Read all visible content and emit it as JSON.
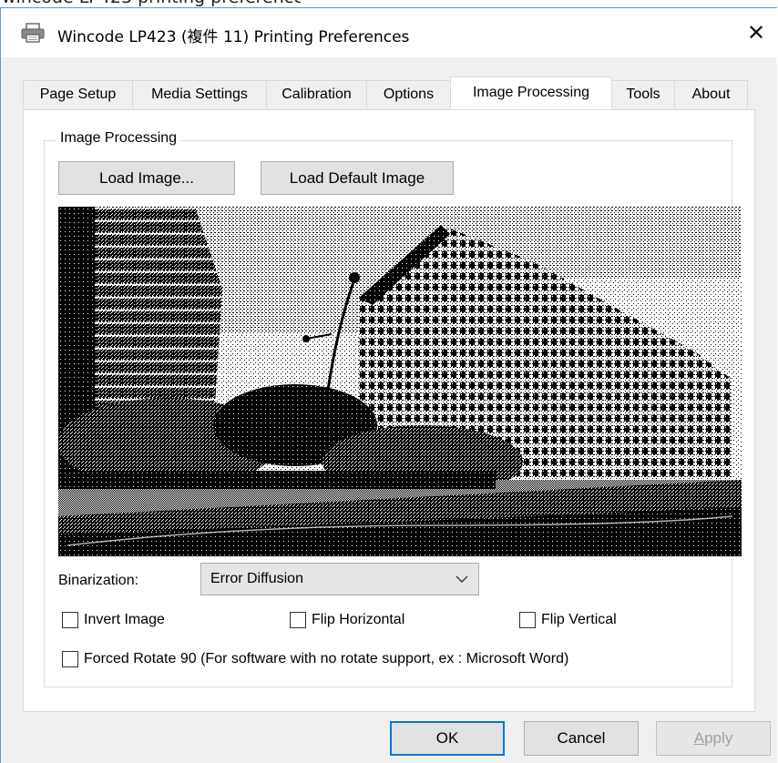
{
  "window": {
    "title": "Wincode LP423 (複件 11) Printing Preferences",
    "close_glyph": "✕",
    "printer_icon": "printer-icon",
    "close_icon": "close-icon"
  },
  "tabs": [
    {
      "label": "Page Setup",
      "active": false
    },
    {
      "label": "Media Settings",
      "active": false
    },
    {
      "label": "Calibration",
      "active": false
    },
    {
      "label": "Options",
      "active": false
    },
    {
      "label": "Image Processing",
      "active": true
    },
    {
      "label": "Tools",
      "active": false
    },
    {
      "label": "About",
      "active": false
    }
  ],
  "image_processing": {
    "group_label": "Image Processing",
    "load_image_label": "Load Image...",
    "load_default_label": "Load Default Image",
    "preview_image": "dithered-photo-buildings",
    "binarization_label": "Binarization:",
    "binarization_value": "Error Diffusion",
    "invert_label": "Invert Image",
    "invert_checked": false,
    "flip_h_label": "Flip Horizontal",
    "flip_h_checked": false,
    "flip_v_label": "Flip Vertical",
    "flip_v_checked": false,
    "rotate_label": "Forced Rotate 90 (For software with no rotate support, ex : Microsoft Word)",
    "rotate_checked": false
  },
  "footer": {
    "ok_label": "OK",
    "cancel_label": "Cancel",
    "apply_label": "Apply",
    "apply_enabled": false
  },
  "colors": {
    "accent": "#0078d7",
    "window_border": "#5b9bd5",
    "dialog_bg": "#f0f0f0"
  }
}
